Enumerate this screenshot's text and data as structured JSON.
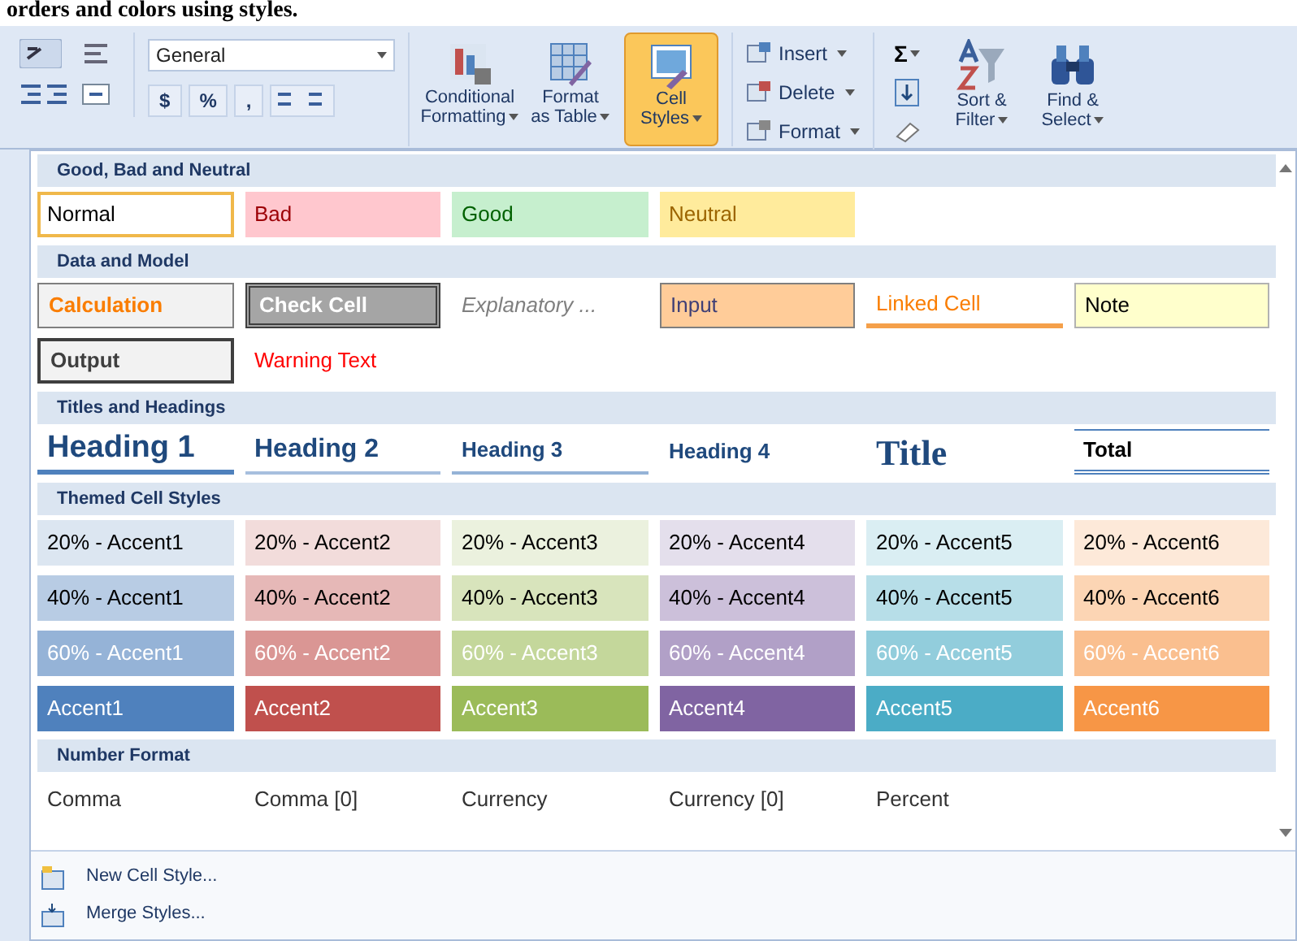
{
  "document_text": "orders and colors using styles.",
  "ribbon": {
    "number_format": "General",
    "number_buttons": [
      {
        "label": "$"
      },
      {
        "label": "%"
      },
      {
        "label": ","
      }
    ],
    "style_buttons": [
      {
        "label_lines": [
          "Conditional",
          "Formatting"
        ],
        "selected": false
      },
      {
        "label_lines": [
          "Format",
          "as Table"
        ],
        "selected": false
      },
      {
        "label_lines": [
          "Cell",
          "Styles"
        ],
        "selected": true
      }
    ],
    "cell_buttons": [
      {
        "label": "Insert"
      },
      {
        "label": "Delete"
      },
      {
        "label": "Format"
      }
    ],
    "sum_symbol": "Σ",
    "editing_buttons": [
      {
        "label_lines": [
          "Sort &",
          "Filter"
        ]
      },
      {
        "label_lines": [
          "Find &",
          "Select"
        ]
      }
    ]
  },
  "gallery": {
    "sections": [
      {
        "title": "Good, Bad and Neutral",
        "rows": [
          [
            {
              "label": "Normal",
              "kind": "normal",
              "selected": true
            },
            {
              "label": "Bad",
              "kind": "bad",
              "selected": false
            },
            {
              "label": "Good",
              "kind": "good",
              "selected": false
            },
            {
              "label": "Neutral",
              "kind": "neutral",
              "selected": false
            }
          ]
        ]
      },
      {
        "title": "Data and Model",
        "rows": [
          [
            {
              "label": "Calculation",
              "kind": "calculation",
              "selected": false
            },
            {
              "label": "Check Cell",
              "kind": "check",
              "selected": false
            },
            {
              "label": "Explanatory ...",
              "kind": "explanatory",
              "selected": false
            },
            {
              "label": "Input",
              "kind": "input",
              "selected": false
            },
            {
              "label": "Linked Cell",
              "kind": "linked",
              "selected": false
            },
            {
              "label": "Note",
              "kind": "note",
              "selected": false
            }
          ],
          [
            {
              "label": "Output",
              "kind": "output",
              "selected": false
            },
            {
              "label": "Warning Text",
              "kind": "warning",
              "selected": false
            }
          ]
        ]
      },
      {
        "title": "Titles and Headings",
        "rows": [
          [
            {
              "label": "Heading 1",
              "kind": "heading1",
              "selected": false
            },
            {
              "label": "Heading 2",
              "kind": "heading2",
              "selected": false
            },
            {
              "label": "Heading 3",
              "kind": "heading3",
              "selected": false
            },
            {
              "label": "Heading 4",
              "kind": "heading4",
              "selected": false
            },
            {
              "label": "Title",
              "kind": "title",
              "selected": false
            },
            {
              "label": "Total",
              "kind": "total",
              "selected": false
            }
          ]
        ]
      },
      {
        "title": "Themed Cell Styles",
        "rows": [
          [
            {
              "label": "20% - Accent1",
              "kind": "a1_20",
              "selected": false
            },
            {
              "label": "20% - Accent2",
              "kind": "a2_20",
              "selected": false
            },
            {
              "label": "20% - Accent3",
              "kind": "a3_20",
              "selected": false
            },
            {
              "label": "20% - Accent4",
              "kind": "a4_20",
              "selected": false
            },
            {
              "label": "20% - Accent5",
              "kind": "a5_20",
              "selected": false
            },
            {
              "label": "20% - Accent6",
              "kind": "a6_20",
              "selected": false
            }
          ],
          [
            {
              "label": "40% - Accent1",
              "kind": "a1_40",
              "selected": false
            },
            {
              "label": "40% - Accent2",
              "kind": "a2_40",
              "selected": false
            },
            {
              "label": "40% - Accent3",
              "kind": "a3_40",
              "selected": false
            },
            {
              "label": "40% - Accent4",
              "kind": "a4_40",
              "selected": false
            },
            {
              "label": "40% - Accent5",
              "kind": "a5_40",
              "selected": false
            },
            {
              "label": "40% - Accent6",
              "kind": "a6_40",
              "selected": false
            }
          ],
          [
            {
              "label": "60% - Accent1",
              "kind": "a1_60",
              "selected": false
            },
            {
              "label": "60% - Accent2",
              "kind": "a2_60",
              "selected": false
            },
            {
              "label": "60% - Accent3",
              "kind": "a3_60",
              "selected": false
            },
            {
              "label": "60% - Accent4",
              "kind": "a4_60",
              "selected": false
            },
            {
              "label": "60% - Accent5",
              "kind": "a5_60",
              "selected": false
            },
            {
              "label": "60% - Accent6",
              "kind": "a6_60",
              "selected": false
            }
          ],
          [
            {
              "label": "Accent1",
              "kind": "a1",
              "selected": false
            },
            {
              "label": "Accent2",
              "kind": "a2",
              "selected": false
            },
            {
              "label": "Accent3",
              "kind": "a3",
              "selected": false
            },
            {
              "label": "Accent4",
              "kind": "a4",
              "selected": false
            },
            {
              "label": "Accent5",
              "kind": "a5",
              "selected": false
            },
            {
              "label": "Accent6",
              "kind": "a6",
              "selected": false
            }
          ]
        ]
      },
      {
        "title": "Number Format",
        "rows": [
          [
            {
              "label": "Comma",
              "kind": "number",
              "selected": false
            },
            {
              "label": "Comma [0]",
              "kind": "number",
              "selected": false
            },
            {
              "label": "Currency",
              "kind": "number",
              "selected": false
            },
            {
              "label": "Currency [0]",
              "kind": "number",
              "selected": false
            },
            {
              "label": "Percent",
              "kind": "number",
              "selected": false
            }
          ]
        ]
      }
    ]
  },
  "menu_items": [
    {
      "label": "New Cell Style...",
      "kind": "new"
    },
    {
      "label": "Merge Styles...",
      "kind": "merge"
    }
  ]
}
